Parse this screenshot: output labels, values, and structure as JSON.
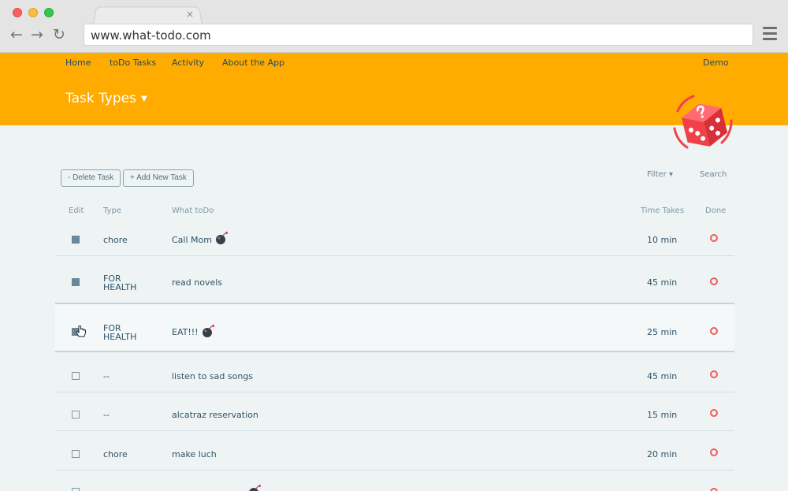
{
  "browser": {
    "url": "www.what-todo.com",
    "tab_close": "×"
  },
  "nav": {
    "home": "Home",
    "todo_tasks": "toDo Tasks",
    "activity": "Activity",
    "about": "About the App",
    "user": "Demo"
  },
  "page": {
    "title": "Task Types"
  },
  "toolbar": {
    "delete_label": "- Delete Task",
    "add_label": "+ Add New Task",
    "filter_label": "Filter ▾",
    "search_label": "Search"
  },
  "table": {
    "headers": {
      "edit": "Edit",
      "type": "Type",
      "what": "What toDo",
      "time": "Time Takes",
      "done": "Done"
    },
    "rows": [
      {
        "type": "chore",
        "what": "Call Mom",
        "time": "10 min",
        "checked": true,
        "bomb": true
      },
      {
        "type": "FOR\nHEALTH",
        "what": "read novels",
        "time": "45 min",
        "checked": true,
        "bomb": false
      },
      {
        "type": "FOR\nHEALTH",
        "what": "EAT!!!",
        "time": "25 min",
        "checked": true,
        "bomb": true
      },
      {
        "type": "--",
        "what": "listen to sad songs",
        "time": "45 min",
        "checked": false,
        "bomb": false
      },
      {
        "type": "--",
        "what": "alcatraz reservation",
        "time": "15 min",
        "checked": false,
        "bomb": false
      },
      {
        "type": "chore",
        "what": "make luch",
        "time": "20 min",
        "checked": false,
        "bomb": false
      }
    ]
  },
  "colors": {
    "header": "#ffab00",
    "nav_text": "#1f4b66",
    "done_ring": "#f05b5b",
    "dice": "#f0414a"
  }
}
